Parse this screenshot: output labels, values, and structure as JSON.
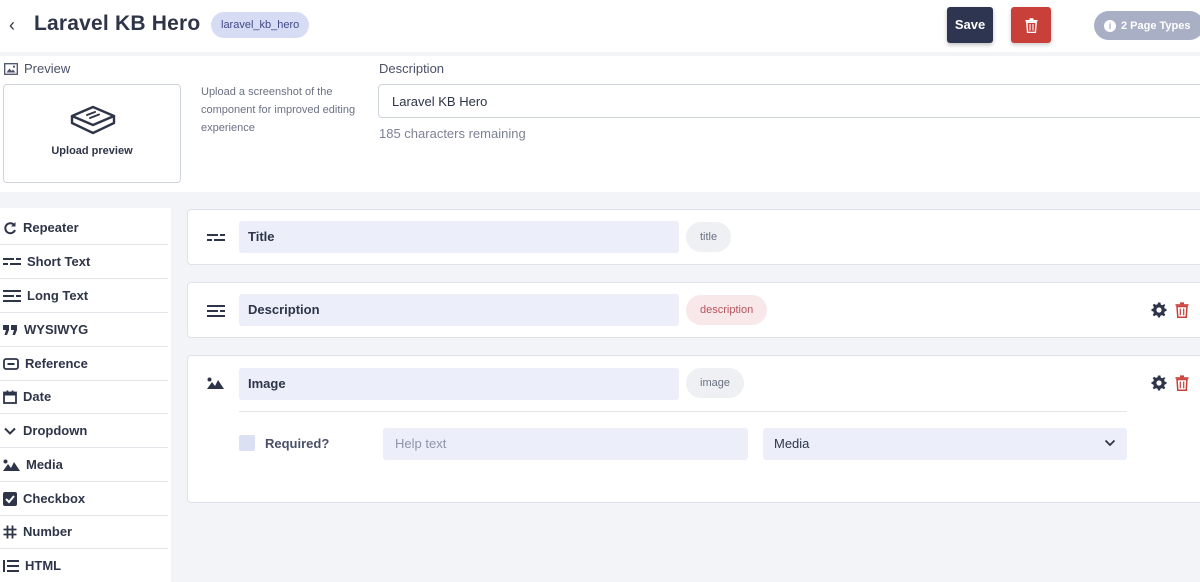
{
  "header": {
    "back_glyph": "‹",
    "title": "Laravel KB Hero",
    "handle": "laravel_kb_hero",
    "save_label": "Save",
    "page_types_label": "2 Page Types",
    "info_glyph": "i"
  },
  "preview": {
    "label": "Preview",
    "upload_label": "Upload preview",
    "hint": "Upload a screenshot of the component for improved editing experience"
  },
  "description": {
    "label": "Description",
    "value": "Laravel KB Hero",
    "chars_remaining": "185 characters remaining"
  },
  "sidebar": {
    "items": [
      {
        "label": "Repeater",
        "icon": "repeat-icon"
      },
      {
        "label": "Short Text",
        "icon": "short-text-icon"
      },
      {
        "label": "Long Text",
        "icon": "long-text-icon"
      },
      {
        "label": "WYSIWYG",
        "icon": "quote-icon"
      },
      {
        "label": "Reference",
        "icon": "link-icon"
      },
      {
        "label": "Date",
        "icon": "calendar-icon"
      },
      {
        "label": "Dropdown",
        "icon": "chevron-down-icon"
      },
      {
        "label": "Media",
        "icon": "image-icon"
      },
      {
        "label": "Checkbox",
        "icon": "checkbox-icon"
      },
      {
        "label": "Number",
        "icon": "hash-icon"
      },
      {
        "label": "HTML",
        "icon": "list-icon"
      }
    ]
  },
  "fields": [
    {
      "name": "Title",
      "handle": "title",
      "icon": "short-text-icon"
    },
    {
      "name": "Description",
      "handle": "description",
      "icon": "long-text-icon"
    },
    {
      "name": "Image",
      "handle": "image",
      "icon": "image-icon",
      "required_label": "Required?",
      "help_placeholder": "Help text",
      "type_value": "Media"
    }
  ],
  "colors": {
    "primary": "#2d3550",
    "danger": "#c9403b",
    "badge": "#d7dcf5",
    "input_bg": "#eceffa"
  }
}
